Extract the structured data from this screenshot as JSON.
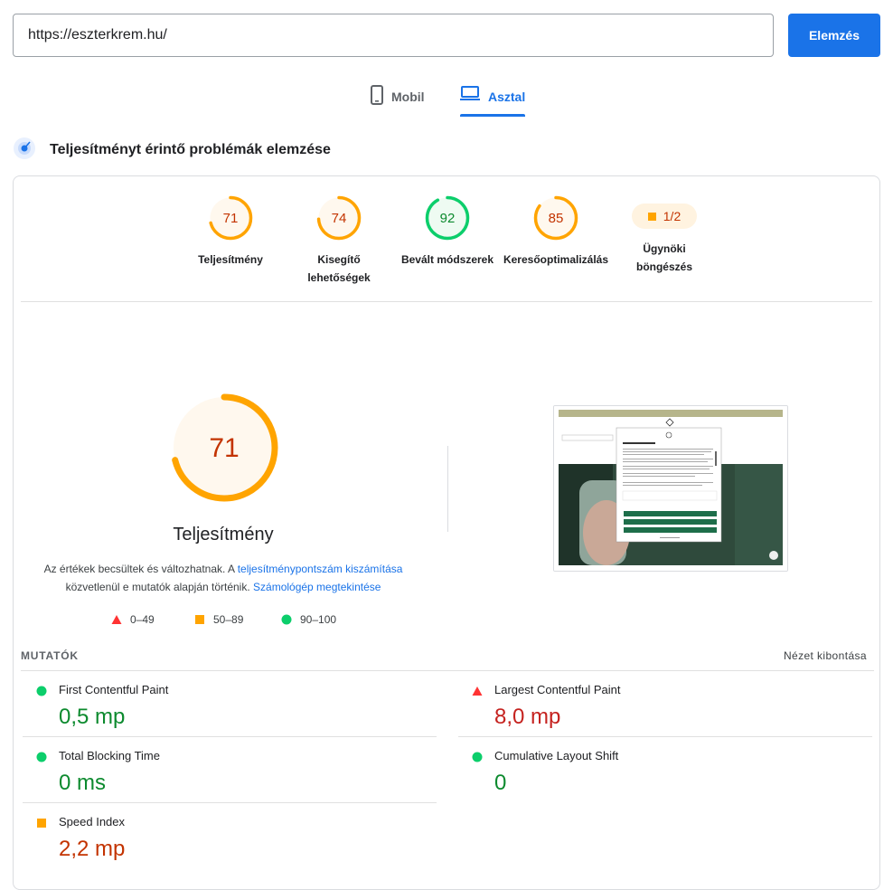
{
  "search": {
    "url": "https://eszterkrem.hu/",
    "button_label": "Elemzés"
  },
  "tabs": [
    {
      "label": "Mobil",
      "active": false
    },
    {
      "label": "Asztal",
      "active": true
    }
  ],
  "section": {
    "title": "Teljesítményt érintő problémák elemzése"
  },
  "scores": [
    {
      "value": "71",
      "score": 71,
      "label": "Teljesítmény",
      "status": "average"
    },
    {
      "value": "74",
      "score": 74,
      "label": "Kisegítő lehetőségek",
      "status": "average"
    },
    {
      "value": "92",
      "score": 92,
      "label": "Bevált módszerek",
      "status": "pass"
    },
    {
      "value": "85",
      "score": 85,
      "label": "Keresőoptimalizálás",
      "status": "average"
    }
  ],
  "agentic": {
    "value": "1/2",
    "label": "Ügynöki böngészés"
  },
  "performance": {
    "score": "71",
    "score_fraction": 0.71,
    "title": "Teljesítmény",
    "desc_part1": "Az értékek becsültek és változhatnak. A ",
    "link1": "teljesítménypontszám kiszámítása",
    "desc_part2": " közvetlenül e mutatók alapján történik. ",
    "link2": "Számológép megtekintése"
  },
  "legend": [
    {
      "range": "0–49",
      "shape": "triangle",
      "color": "#f33"
    },
    {
      "range": "50–89",
      "shape": "square",
      "color": "#ffa400"
    },
    {
      "range": "90–100",
      "shape": "circle",
      "color": "#0cce6b"
    }
  ],
  "metrics_header": {
    "title": "MUTATÓK",
    "expand_label": "Nézet kibontása"
  },
  "metrics": [
    {
      "name": "First Contentful Paint",
      "value": "0,5 mp",
      "status": "pass"
    },
    {
      "name": "Largest Contentful Paint",
      "value": "8,0 mp",
      "status": "fail"
    },
    {
      "name": "Total Blocking Time",
      "value": "0 ms",
      "status": "pass"
    },
    {
      "name": "Cumulative Layout Shift",
      "value": "0",
      "status": "pass"
    },
    {
      "name": "Speed Index",
      "value": "2,2 mp",
      "status": "average"
    }
  ],
  "colors": {
    "accent": "#1a73e8",
    "pass": "#0cce6b",
    "average": "#ffa400",
    "fail": "#ff3333",
    "pass_text": "#0c8a2e",
    "average_text": "#c33300",
    "fail_text": "#c5221f"
  }
}
